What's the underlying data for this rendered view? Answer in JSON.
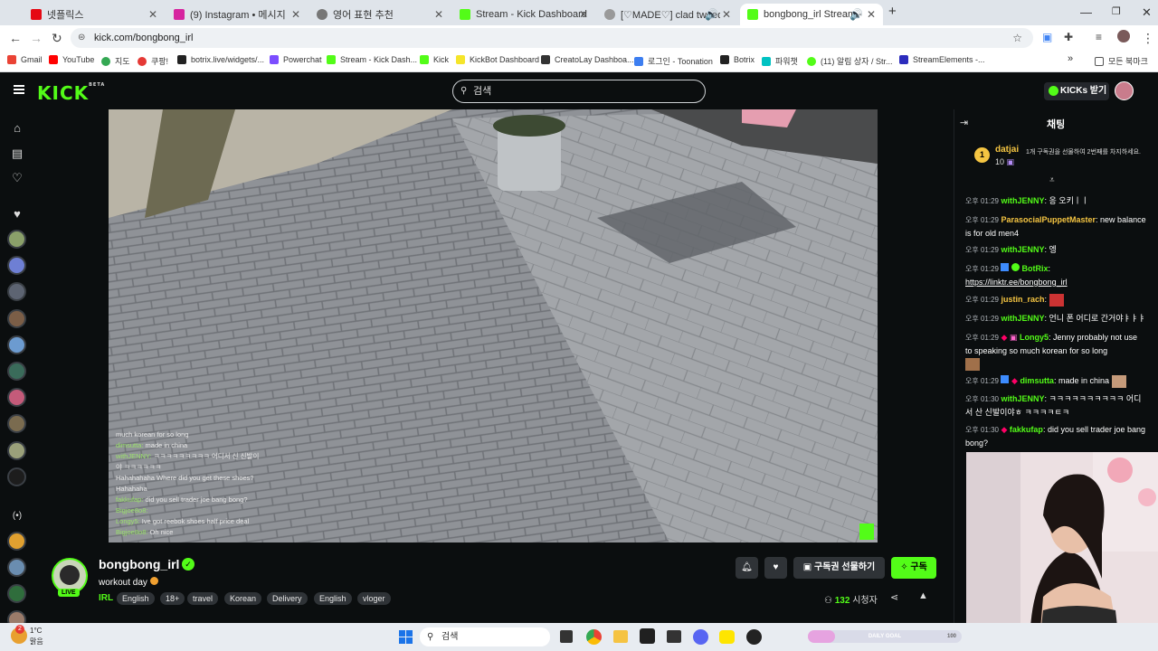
{
  "browser": {
    "tabs": [
      {
        "label": "넷플릭스",
        "color": "#e50914"
      },
      {
        "label": "(9) Instagram • 메시지",
        "color": "#d6249f"
      },
      {
        "label": "영어 표현 추천",
        "color": "#666666"
      },
      {
        "label": "Stream - Kick Dashboard",
        "color": "#53fc18"
      },
      {
        "label": "[♡MADE♡] clad tweed low sl",
        "color": "#888888"
      },
      {
        "label": "bongbong_irl Stream - Wa",
        "color": "#53fc18"
      }
    ],
    "new_tab": "+",
    "url": "kick.com/bongbong_irl",
    "bookmarks": [
      "Gmail",
      "YouTube",
      "지도",
      "쿠팡!",
      "botrix.live/widgets/...",
      "Powerchat",
      "Stream - Kick Dash...",
      "Kick",
      "KickBot Dashboard",
      "CreatoLay Dashboa...",
      "로그인 - Toonation",
      "Botrix",
      "파워챗",
      "(11) 알림 상자 / Str...",
      "StreamElements -..."
    ],
    "bookmarks_more": "»",
    "all_bookmarks": "모든 북마크"
  },
  "kick": {
    "logo": "KICK",
    "logo_beta": "BETA",
    "search_placeholder": "검색",
    "kicks_button": "KICKs 받기"
  },
  "stream": {
    "channel": "bongbong_irl",
    "title": "workout day",
    "live_badge": "LIVE",
    "category": "IRL",
    "tags": [
      "English",
      "18+",
      "travel",
      "Korean",
      "Delivery",
      "English",
      "vloger"
    ],
    "gift_sub_button": "구독권 선물하기",
    "subscribe_button": "구독",
    "viewer_count": "132",
    "viewer_label": "시청자"
  },
  "overlay_chat": [
    {
      "user": "",
      "text": "much korean for so long"
    },
    {
      "user": "dimsutta:",
      "text": "made in china"
    },
    {
      "user": "withJENNY:",
      "text": "ㅋㅋㅋㅋㅋㅋㅋㅋㅋ 어디서 신 신발이"
    },
    {
      "user": "",
      "text": "야 ㅋㅋㅋㅋㅋㅋ"
    },
    {
      "user": "",
      "text": "Hahahahaha Where did you get these shoes?"
    },
    {
      "user": "",
      "text": "Hahahaha"
    },
    {
      "user": "fakkufap:",
      "text": "did you sell trader joe bang bong?"
    },
    {
      "user": "Bigjoe8o8:",
      "text": ""
    },
    {
      "user": "Longy5:",
      "text": "Ive got reebok shoes half price deal"
    },
    {
      "user": "Bigjoe8o8:",
      "text": "Oh nice"
    }
  ],
  "chat": {
    "header": "채팅",
    "pinned": {
      "rank": "1",
      "user": "datjai",
      "count": "10",
      "text": "1개 구독권을 선물하여 2번째를 차지하세요."
    },
    "messages": [
      {
        "time": "오후 01:29",
        "user": "withJENNY",
        "color": "#53fc18",
        "text": "응 오키ㅣㅣ"
      },
      {
        "time": "오후 01:29",
        "user": "ParasocialPuppetMaster",
        "color": "#f5c542",
        "text": "new balance is for old men4"
      },
      {
        "time": "오후 01:29",
        "user": "withJENNY",
        "color": "#53fc18",
        "text": "엥"
      },
      {
        "time": "오후 01:29",
        "user": "BotRix",
        "color": "#53fc18",
        "text": "https://linktr.ee/bongbong_irl"
      },
      {
        "time": "오후 01:29",
        "user": "justin_rach",
        "color": "#f5c542",
        "text": ""
      },
      {
        "time": "오후 01:29",
        "user": "withJENNY",
        "color": "#53fc18",
        "text": "언니 폰 어디로 간거야ㅑㅑㅑ"
      },
      {
        "time": "오후 01:29",
        "user": "Longy5",
        "color": "#53fc18",
        "text": "Jenny probably not use to speaking so much korean for so long"
      },
      {
        "time": "오후 01:29",
        "user": "dimsutta",
        "color": "#53fc18",
        "text": "made in china"
      },
      {
        "time": "오후 01:30",
        "user": "withJENNY",
        "color": "#53fc18",
        "text": "ㅋㅋㅋㅋㅋㅋㅋㅋㅋㅋ 어디서 산 신발이야ㅎ ㅋㅋㅋㅋㅌㅋ"
      },
      {
        "time": "오후 01:30",
        "user": "fakkufap",
        "color": "#53fc18",
        "text": "did you sell trader joe bang bong?"
      }
    ]
  },
  "taskbar": {
    "weather_temp": "1°C",
    "weather_desc": "맑음",
    "weather_badge": "2",
    "search": "검색",
    "daily_goal": "DAILY GOAL",
    "goal_max": "100"
  }
}
